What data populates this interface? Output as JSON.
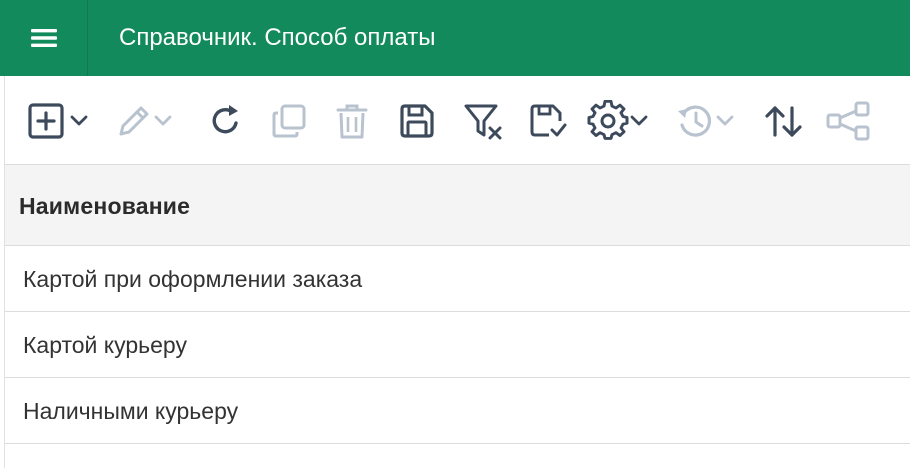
{
  "app": {
    "title": "Справочник. Способ оплаты",
    "menu_icon": "hamburger-icon"
  },
  "colors": {
    "topbar": "#138a5c",
    "icon_active": "#3d4a5c",
    "icon_disabled": "#b8c3cf"
  },
  "toolbar": [
    {
      "name": "add-button",
      "icon": "add-box-icon",
      "dropdown": true,
      "enabled": true
    },
    {
      "name": "edit-button",
      "icon": "pencil-icon",
      "dropdown": true,
      "enabled": false
    },
    {
      "name": "refresh-button",
      "icon": "refresh-icon",
      "dropdown": false,
      "enabled": true
    },
    {
      "name": "copy-button",
      "icon": "copy-icon",
      "dropdown": false,
      "enabled": false
    },
    {
      "name": "delete-button",
      "icon": "trash-icon",
      "dropdown": false,
      "enabled": false
    },
    {
      "name": "save-button",
      "icon": "floppy-icon",
      "dropdown": false,
      "enabled": true
    },
    {
      "name": "clear-filter-button",
      "icon": "filter-clear-icon",
      "dropdown": false,
      "enabled": true
    },
    {
      "name": "save-filter-button",
      "icon": "save-check-icon",
      "dropdown": false,
      "enabled": true
    },
    {
      "name": "settings-button",
      "icon": "gear-icon",
      "dropdown": true,
      "enabled": true
    },
    {
      "name": "history-button",
      "icon": "history-icon",
      "dropdown": true,
      "enabled": false
    },
    {
      "name": "sort-button",
      "icon": "sort-arrows-icon",
      "dropdown": false,
      "enabled": true
    },
    {
      "name": "share-button",
      "icon": "share-nodes-icon",
      "dropdown": false,
      "enabled": false
    }
  ],
  "table": {
    "columns": [
      "Наименование"
    ],
    "rows": [
      {
        "name": "Картой при оформлении заказа"
      },
      {
        "name": "Картой курьеру"
      },
      {
        "name": "Наличными курьеру"
      }
    ]
  }
}
